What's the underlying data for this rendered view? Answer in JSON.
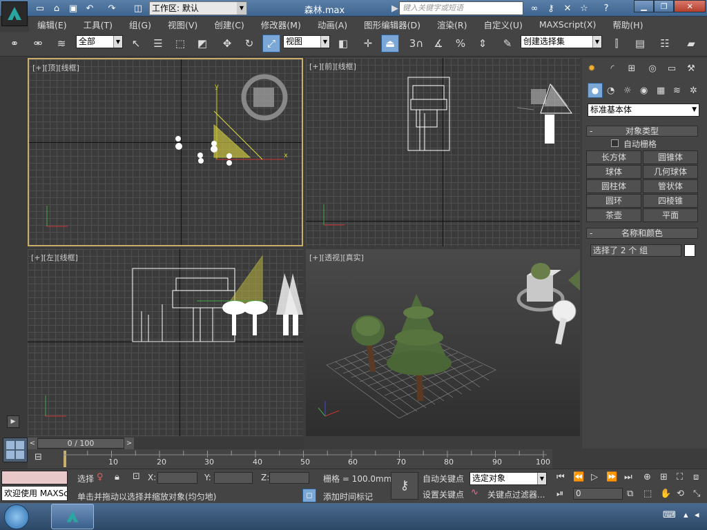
{
  "titlebar": {
    "workspace": "工作区: 默认",
    "filename": "森林.max",
    "search_placeholder": "键入关键字或短语"
  },
  "menu": [
    "编辑(E)",
    "工具(T)",
    "组(G)",
    "视图(V)",
    "创建(C)",
    "修改器(M)",
    "动画(A)",
    "图形编辑器(D)",
    "渲染(R)",
    "自定义(U)",
    "MAXScript(X)",
    "帮助(H)"
  ],
  "toolbar": {
    "filter": "全部",
    "ref_coord": "视图",
    "snap_3": "3",
    "named_sel": "创建选择集"
  },
  "viewports": {
    "top": "[+][顶][线框]",
    "front": "[+][前][线框]",
    "left": "[+][左][线框]",
    "perspective": "[+][透视][真实]"
  },
  "panel": {
    "category": "标准基本体",
    "object_type_title": "对象类型",
    "autogrid_label": "自动栅格",
    "buttons": [
      "长方体",
      "圆锥体",
      "球体",
      "几何球体",
      "圆柱体",
      "管状体",
      "圆环",
      "四棱锥",
      "茶壶",
      "平面"
    ],
    "name_color_title": "名称和颜色",
    "name_value": "选择了 2 个 组"
  },
  "timeline": {
    "frame": "0 / 100",
    "ticks": [
      "10",
      "20",
      "30",
      "40",
      "50",
      "60",
      "70",
      "80",
      "90",
      "100"
    ]
  },
  "status": {
    "maxscript": "欢迎使用 MAXSc",
    "sel_label": "选择",
    "x_label": "X:",
    "y_label": "Y:",
    "z_label": "Z:",
    "grid": "栅格 = 100.0mm",
    "autokey": "自动关键点",
    "setkey": "设置关键点",
    "sel_object": "选定对象",
    "key_filters": "关键点过滤器...",
    "add_time_tag": "添加时间标记",
    "prompt": "单击并拖动以选择并缩放对象(均匀地)",
    "frame_field": "0"
  },
  "colors": {
    "accent": "#7aa7d6",
    "active_border": "#c8b06a"
  }
}
